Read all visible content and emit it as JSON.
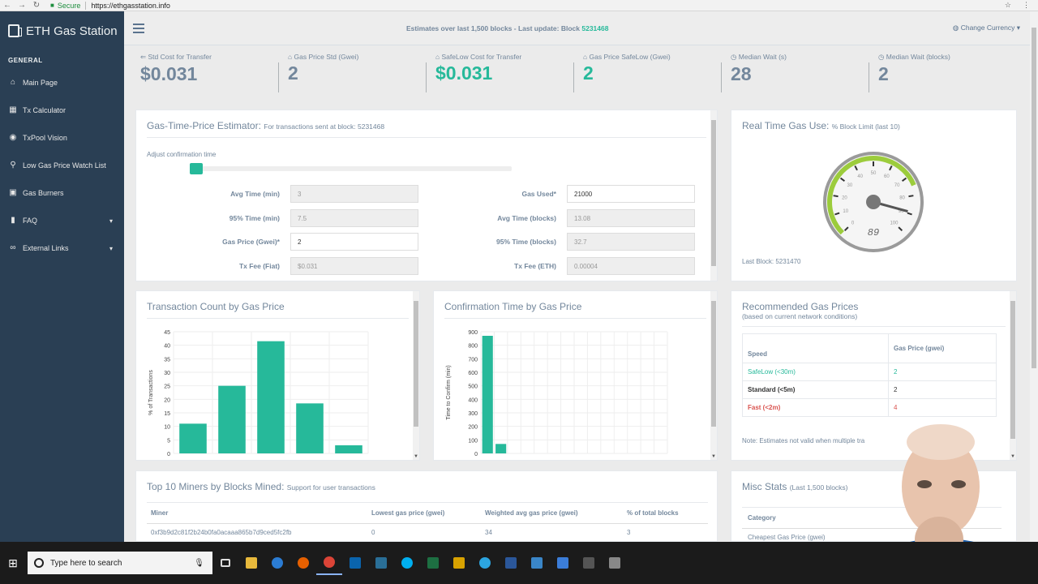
{
  "browser": {
    "secure_label": "Secure",
    "url": "https://ethgasstation.info"
  },
  "sidebar": {
    "brand": "ETH Gas Station",
    "section": "GENERAL",
    "items": [
      {
        "label": "Main Page",
        "icon": "home-icon"
      },
      {
        "label": "Tx Calculator",
        "icon": "calculator-icon"
      },
      {
        "label": "TxPool Vision",
        "icon": "eye-icon"
      },
      {
        "label": "Low Gas Price Watch List",
        "icon": "bicycle-icon"
      },
      {
        "label": "Gas Burners",
        "icon": "car-icon"
      },
      {
        "label": "FAQ",
        "icon": "book-icon",
        "expandable": true
      },
      {
        "label": "External Links",
        "icon": "link-icon",
        "expandable": true
      }
    ]
  },
  "header": {
    "estimates_text": "Estimates over last 1,500 blocks - Last update: Block",
    "block": "5231468",
    "currency_label": "Change Currency"
  },
  "tiles": [
    {
      "label": "Std Cost for Transfer",
      "value": "$0.031",
      "green": false
    },
    {
      "label": "Gas Price Std (Gwei)",
      "value": "2",
      "green": false
    },
    {
      "label": "SafeLow Cost for Transfer",
      "value": "$0.031",
      "green": true
    },
    {
      "label": "Gas Price SafeLow (Gwei)",
      "value": "2",
      "green": true
    },
    {
      "label": "Median Wait (s)",
      "value": "28",
      "green": false
    },
    {
      "label": "Median Wait (blocks)",
      "value": "2",
      "green": false
    }
  ],
  "estimator": {
    "title": "Gas-Time-Price Estimator:",
    "subtitle": "For transactions sent at block: 5231468",
    "slider_label": "Adjust confirmation time",
    "slider_fraction": 0.02,
    "left_fields": [
      {
        "label": "Avg Time (min)",
        "value": "3",
        "editable": false
      },
      {
        "label": "95% Time (min)",
        "value": "7.5",
        "editable": false
      },
      {
        "label": "Gas Price (Gwei)*",
        "value": "2",
        "editable": true
      },
      {
        "label": "Tx Fee (Fiat)",
        "value": "$0.031",
        "editable": false
      }
    ],
    "right_fields": [
      {
        "label": "Gas Used*",
        "value": "21000",
        "editable": true
      },
      {
        "label": "Avg Time (blocks)",
        "value": "13.08",
        "editable": false
      },
      {
        "label": "95% Time (blocks)",
        "value": "32.7",
        "editable": false
      },
      {
        "label": "Tx Fee (ETH)",
        "value": "0.00004",
        "editable": false
      }
    ]
  },
  "gas_use": {
    "title": "Real Time Gas Use:",
    "subtitle": "% Block Limit (last 10)",
    "gauge_value": 89,
    "gauge_display": "89",
    "gauge_ticks": [
      "0",
      "10",
      "20",
      "30",
      "40",
      "50",
      "60",
      "70",
      "80",
      "90",
      "100"
    ],
    "last_block_label": "Last Block: 5231470",
    "colors": {
      "arc": "#9ccc3c",
      "face": "#ffffff",
      "rim": "#9a9a9a"
    }
  },
  "tx_count": {
    "title": "Transaction Count by Gas Price"
  },
  "conf_time": {
    "title": "Confirmation Time by Gas Price"
  },
  "chart_data": [
    {
      "type": "bar",
      "title": "Transaction Count by Gas Price",
      "ylabel": "% of Transactions",
      "xlabel": "",
      "ylim": [
        0,
        45
      ],
      "yticks": [
        "0",
        "5",
        "10",
        "15",
        "20",
        "25",
        "30",
        "35",
        "40",
        "45"
      ],
      "values": [
        11,
        25,
        41.5,
        18.5,
        3
      ],
      "color": "#26b99a",
      "grid": true
    },
    {
      "type": "bar",
      "title": "Confirmation Time by Gas Price",
      "ylabel": "Time to Confirm (min)",
      "xlabel": "",
      "ylim": [
        0,
        900
      ],
      "yticks": [
        "0",
        "100",
        "200",
        "300",
        "400",
        "500",
        "600",
        "700",
        "800",
        "900"
      ],
      "values": [
        870,
        70,
        0,
        0,
        0,
        0,
        0,
        0,
        0,
        0,
        0,
        0,
        0,
        0
      ],
      "color": "#26b99a",
      "grid": true
    }
  ],
  "recommended": {
    "title": "Recommended Gas Prices",
    "subtitle": "(based on current network conditions)",
    "col_speed": "Speed",
    "col_price": "Gas Price (gwei)",
    "rows": [
      {
        "speed": "SafeLow (<30m)",
        "price": "2",
        "color": "#26b99a"
      },
      {
        "speed": "Standard (<5m)",
        "price": "2",
        "color": "#333333"
      },
      {
        "speed": "Fast (<2m)",
        "price": "4",
        "color": "#d9534f"
      }
    ],
    "note": "Note: Estimates not valid when multiple tra"
  },
  "miners": {
    "title": "Top 10 Miners by Blocks Mined:",
    "subtitle": "Support for user transactions",
    "columns": [
      "Miner",
      "Lowest gas price (gwei)",
      "Weighted avg gas price (gwei)",
      "% of total blocks"
    ],
    "rows": [
      [
        "0xf3b9d2c81f2b24b0fa0acaaa865b7d9ced5fc2fb",
        "0",
        "34",
        "3"
      ]
    ]
  },
  "misc": {
    "title": "Misc Stats",
    "subtitle": "(Last 1,500 blocks)",
    "col_category": "Category",
    "row": "Cheapest Gas Price (gwei)"
  },
  "taskbar": {
    "search_placeholder": "Type here to search"
  }
}
